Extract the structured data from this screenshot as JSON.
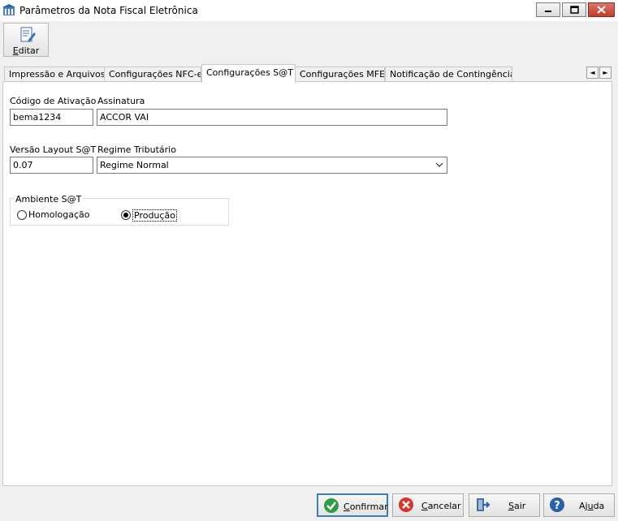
{
  "window": {
    "title": "Parâmetros da Nota Fiscal Eletrônica"
  },
  "toolbar": {
    "edit_label_first": "E",
    "edit_label_rest": "ditar"
  },
  "tabs": [
    {
      "label": "Impressão e Arquivos",
      "active": false
    },
    {
      "label": "Configurações NFC-e",
      "active": false
    },
    {
      "label": "Configurações S@T",
      "active": true
    },
    {
      "label": "Configurações MFE",
      "active": false
    },
    {
      "label": "Notificação de Contingência",
      "active": false
    }
  ],
  "tab_scroll": {
    "left": "◄",
    "right": "►"
  },
  "form": {
    "activation_code": {
      "label": "Código de Ativação",
      "value": "bema1234"
    },
    "signature": {
      "label": "Assinatura",
      "value": "ACCOR VAI"
    },
    "layout_version": {
      "label": "Versão Layout S@T",
      "value": "0.07"
    },
    "tax_regime": {
      "label": "Regime Tributário",
      "value": "Regime Normal"
    },
    "environment": {
      "title": "Ambiente S@T",
      "options": [
        {
          "label": "Homologação",
          "selected": false
        },
        {
          "label": "Produção",
          "selected": true
        }
      ]
    }
  },
  "buttons": {
    "confirm": {
      "first": "Confirmar",
      "ul": "C",
      "rest": "onfirmar"
    },
    "cancel": {
      "ul": "C",
      "rest": "ancelar"
    },
    "exit": {
      "ul": "S",
      "rest": "air"
    },
    "help": {
      "first": "Aj",
      "ul": "u",
      "rest": "da"
    }
  },
  "colors": {
    "confirm_icon": "#2e9e46",
    "cancel_icon": "#d9362a",
    "help_icon": "#2b5fa8",
    "default_button_border": "#3c7fb1"
  }
}
